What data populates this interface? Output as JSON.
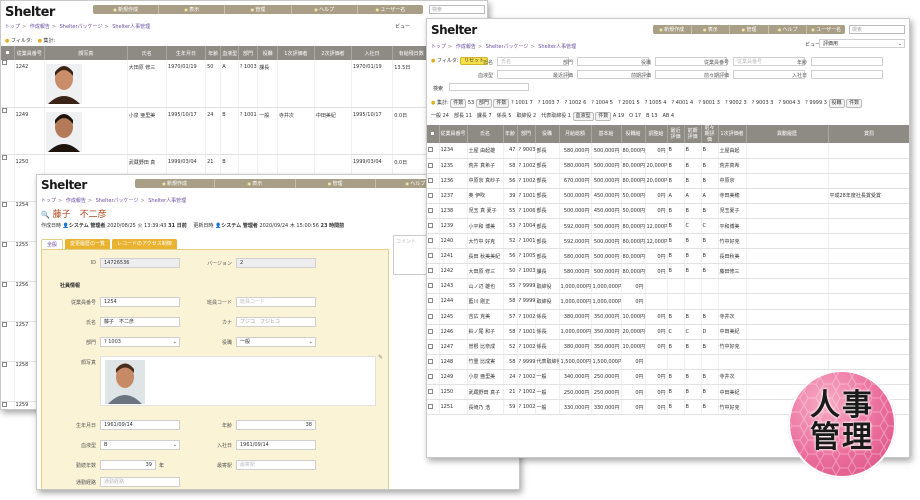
{
  "menu": [
    "新規作成",
    "表示",
    "管理",
    "ヘルプ",
    "ユーザー名"
  ],
  "search_placeholder": "検索",
  "logo": "Shelter",
  "breadcrumb": [
    "トップ",
    "作成報告",
    "Shelterパッケージ",
    "Shelter人事管理"
  ],
  "view_label": "ビュー",
  "view_value": "評価用",
  "filter_label": "フィルタ:",
  "reset_label": "リセット",
  "total_label": "集計:",
  "w1": {
    "headers": [
      "",
      "従業員番号",
      "顔写真",
      "氏名",
      "生年月日",
      "年齢",
      "血液型",
      "部門",
      "役職",
      "1次評価者",
      "2次評価者",
      "入社日",
      "有給残日数",
      "携帯電話番号"
    ],
    "rows": [
      {
        "id": "1242",
        "name": "大田原 修三",
        "birth": "1970/01/19",
        "age": "50",
        "blood": "A",
        "dept": "? 1003",
        "pos": "課長",
        "e1": "",
        "e2": "",
        "join": "1970/01/19",
        "paid": "13.5日",
        "tel": "010-2345-6789"
      },
      {
        "id": "1249",
        "name": "小泉 亜里美",
        "birth": "1995/10/17",
        "age": "24",
        "blood": "B",
        "dept": "? 1001",
        "pos": "一般",
        "e1": "寺井次",
        "e2": "中田美紀",
        "join": "1995/10/17",
        "paid": "0.0日",
        "tel": "010-2345-6789"
      },
      {
        "id": "1250",
        "name": "武蔵野田 真",
        "birth": "1999/03/04",
        "age": "21",
        "blood": "B",
        "dept": "",
        "pos": "",
        "e1": "",
        "e2": "",
        "join": "1999/03/04",
        "paid": "0.0日",
        "tel": "010-2345-6789"
      }
    ],
    "extra_ids": [
      "1254",
      "1255",
      "1256",
      "1257",
      "1258",
      "1259"
    ]
  },
  "w2": {
    "header_name": "藤子　不二彦",
    "created_label": "作成日時",
    "created_by": "システム 管理者",
    "created_at": "2020/08/25 火 13:39:43",
    "created_ago": "31 日前",
    "updated_label": "更新日時",
    "updated_by": "システム 管理者",
    "updated_at": "2020/09/24 木 15:00:56",
    "updated_ago": "23 時間前",
    "comment_placeholder": "コメント",
    "tabs": [
      "全般",
      "変更履歴の一覧",
      "レコードのアクセス制御"
    ],
    "id_label": "ID",
    "id_value": "14726536",
    "version_label": "バージョン",
    "version_value": "2",
    "section_label": "社員情報",
    "emp_no_label": "従業員番号",
    "emp_no_value": "1254",
    "shift_label": "班員コード",
    "shift_placeholder": "班員コード",
    "name_label": "氏名",
    "name_value": "藤子　不二彦",
    "kana_label": "カナ",
    "kana_value": "フジコ　フジヒコ",
    "dept_label": "部門",
    "dept_value": "? 1003",
    "pos_label": "役職",
    "pos_value": "一般",
    "photo_label": "顔写真",
    "birth_label": "生年月日",
    "birth_value": "1961/09/14",
    "age_label": "年齢",
    "age_value": "38",
    "blood_label": "血液型",
    "blood_value": "B",
    "join_label": "入社日",
    "join_value": "1961/09/14",
    "service_label": "勤続年数",
    "service_value": "39",
    "service_unit": "年",
    "station_label": "最寄駅",
    "station_placeholder": "最寄駅",
    "route_label": "通勤経路",
    "route_placeholder": "通勤経路"
  },
  "w3": {
    "filters1": [
      {
        "label": "氏名",
        "placeholder": "氏名"
      },
      {
        "label": "部門",
        "placeholder": ""
      },
      {
        "label": "役職",
        "placeholder": ""
      },
      {
        "label": "従業員番号",
        "placeholder": "従業員番号"
      },
      {
        "label": "年齢",
        "placeholder": ""
      }
    ],
    "filters2": [
      {
        "label": "血液型",
        "placeholder": ""
      },
      {
        "label": "最近評価",
        "placeholder": ""
      },
      {
        "label": "前期評価",
        "placeholder": ""
      },
      {
        "label": "前々期評価",
        "placeholder": ""
      },
      {
        "label": "入社日",
        "placeholder": ""
      }
    ],
    "search_label": "検索",
    "total_dropdown": "件数",
    "total_count": "53",
    "dept_btn": "部門",
    "dept_btn2": "件数",
    "dept_counts": "? 1001 7　? 1003 7　? 1002 6　? 1004 5　? 2001 5　? 1005 4　? 4001 4　? 9001 3　? 9002 3　? 9003 3　? 9004 3　? 9999 3",
    "pos_btn": "役職",
    "pos_btn2": "件数",
    "pos_counts": "一般 24　部長 11　課長 7　係長 5　取締役 2　代表取締役 1",
    "blood_btn": "血液型",
    "blood_btn2": "件数",
    "blood_counts": "A 19　O 17　B 13　AB 4",
    "headers": [
      "",
      "従業員番号",
      "氏名",
      "年齢",
      "部門",
      "役職",
      "月給総額",
      "基本給",
      "役職給",
      "調整給",
      "最近評価",
      "前期評価",
      "前々期評価",
      "1次評価者",
      "異動履歴",
      "賞罰"
    ],
    "rows": [
      {
        "id": "1234",
        "name": "土屋 由起雄",
        "age": "47",
        "dept": "? 9003",
        "pos": "部長",
        "total": "580,000円",
        "base": "500,000円",
        "role": "80,000円",
        "adj": "0円",
        "r1": "B",
        "r2": "B",
        "r3": "B",
        "e1": "土屋由起",
        "move": "",
        "award": ""
      },
      {
        "id": "1235",
        "name": "荒井 真希子",
        "age": "58",
        "dept": "? 1002",
        "pos": "部長",
        "total": "580,000円",
        "base": "500,000円",
        "role": "80,000円",
        "adj": "20,000円",
        "r1": "B",
        "r2": "B",
        "r3": "B",
        "e1": "荒井真希",
        "move": "",
        "award": ""
      },
      {
        "id": "1236",
        "name": "中原京 真紗子",
        "age": "56",
        "dept": "? 1002",
        "pos": "部長",
        "total": "670,000円",
        "base": "500,000円",
        "role": "80,000円",
        "adj": "20,000円",
        "r1": "B",
        "r2": "B",
        "r3": "B",
        "e1": "中原京",
        "move": "",
        "award": ""
      },
      {
        "id": "1237",
        "name": "奥 伊吹",
        "age": "39",
        "dept": "? 1001",
        "pos": "部長",
        "total": "500,000円",
        "base": "450,000円",
        "role": "50,000円",
        "adj": "0円",
        "r1": "A",
        "r2": "A",
        "r3": "A",
        "e1": "寺田美穂",
        "move": "",
        "award": "平成28年度社長賞受賞"
      },
      {
        "id": "1238",
        "name": "児玉 真 夏子",
        "age": "55",
        "dept": "? 1006",
        "pos": "部長",
        "total": "500,000円",
        "base": "450,000円",
        "role": "50,000円",
        "adj": "0円",
        "r1": "B",
        "r2": "B",
        "r3": "B",
        "e1": "児玉夏子",
        "move": "",
        "award": ""
      },
      {
        "id": "1239",
        "name": "小平和 博美",
        "age": "53",
        "dept": "? 1004",
        "pos": "部長",
        "total": "592,000円",
        "base": "500,000円",
        "role": "80,000円",
        "adj": "12,000円",
        "r1": "B",
        "r2": "C",
        "r3": "C",
        "e1": "平和博美",
        "move": "",
        "award": ""
      },
      {
        "id": "1240",
        "name": "大竹中 好克",
        "age": "52",
        "dept": "? 1001",
        "pos": "部長",
        "total": "592,000円",
        "base": "500,000円",
        "role": "80,000円",
        "adj": "12,000円",
        "r1": "B",
        "r2": "B",
        "r3": "B",
        "e1": "竹中好克",
        "move": "",
        "award": ""
      },
      {
        "id": "1241",
        "name": "長田 秋美美紀",
        "age": "56",
        "dept": "? 1005",
        "pos": "部長",
        "total": "580,000円",
        "base": "500,000円",
        "role": "80,000円",
        "adj": "0円",
        "r1": "B",
        "r2": "B",
        "r3": "B",
        "e1": "長田秋美",
        "move": "",
        "award": ""
      },
      {
        "id": "1242",
        "name": "大田原 修三",
        "age": "50",
        "dept": "? 1003",
        "pos": "課長",
        "total": "580,000円",
        "base": "500,000円",
        "role": "80,000円",
        "adj": "0円",
        "r1": "B",
        "r2": "B",
        "r3": "B",
        "e1": "藤田修三",
        "move": "",
        "award": ""
      },
      {
        "id": "1243",
        "name": "山ノ辺 雄也",
        "age": "55",
        "dept": "? 9999",
        "pos": "取締役",
        "total": "1,000,000円",
        "base": "1,000,000円",
        "role": "0円",
        "adj": "",
        "r1": "",
        "r2": "",
        "r3": "",
        "e1": "",
        "move": "",
        "award": ""
      },
      {
        "id": "1244",
        "name": "藍川 剛正",
        "age": "58",
        "dept": "? 9999",
        "pos": "取締役",
        "total": "1,000,000円",
        "base": "1,000,000円",
        "role": "0円",
        "adj": "",
        "r1": "",
        "r2": "",
        "r3": "",
        "e1": "",
        "move": "",
        "award": ""
      },
      {
        "id": "1245",
        "name": "吉広 克美",
        "age": "57",
        "dept": "? 1002",
        "pos": "係長",
        "total": "380,000円",
        "base": "350,000円",
        "role": "10,000円",
        "adj": "0円",
        "r1": "B",
        "r2": "B",
        "r3": "B",
        "e1": "寺井次",
        "move": "",
        "award": ""
      },
      {
        "id": "1246",
        "name": "鈴ノ尾 和子",
        "age": "58",
        "dept": "? 1001",
        "pos": "係長",
        "total": "1,000,000円",
        "base": "350,000円",
        "role": "20,000円",
        "adj": "0円",
        "r1": "C",
        "r2": "C",
        "r3": "D",
        "e1": "中田美紀",
        "move": "",
        "award": ""
      },
      {
        "id": "1247",
        "name": "曽根 比奈成",
        "age": "52",
        "dept": "? 1002",
        "pos": "係長",
        "total": "380,000円",
        "base": "350,000円",
        "role": "10,000円",
        "adj": "0円",
        "r1": "B",
        "r2": "B",
        "r3": "B",
        "e1": "竹中好克",
        "move": "",
        "award": ""
      },
      {
        "id": "1248",
        "name": "竹重 比成実",
        "age": "58",
        "dept": "? 9999",
        "pos": "代表取締役",
        "total": "1,500,000円",
        "base": "1,500,000円",
        "role": "0円",
        "adj": "",
        "r1": "",
        "r2": "",
        "r3": "",
        "e1": "",
        "move": "",
        "award": ""
      },
      {
        "id": "1249",
        "name": "小泉 亜里美",
        "age": "24",
        "dept": "? 1002",
        "pos": "一般",
        "total": "340,000円",
        "base": "250,000円",
        "role": "0円",
        "adj": "0円",
        "r1": "B",
        "r2": "B",
        "r3": "B",
        "e1": "寺井次",
        "move": "",
        "award": ""
      },
      {
        "id": "1250",
        "name": "武蔵野田 真子",
        "age": "21",
        "dept": "? 1002",
        "pos": "一般",
        "total": "250,000円",
        "base": "250,000円",
        "role": "0円",
        "adj": "0円",
        "r1": "B",
        "r2": "B",
        "r3": "B",
        "e1": "中田美紀",
        "move": "",
        "award": ""
      },
      {
        "id": "1251",
        "name": "長崎乃 浩",
        "age": "59",
        "dept": "? 1002",
        "pos": "一般",
        "total": "330,000円",
        "base": "330,000円",
        "role": "0円",
        "adj": "0円",
        "r1": "B",
        "r2": "B",
        "r3": "B",
        "e1": "竹中好克",
        "move": "",
        "award": ""
      }
    ]
  },
  "badge_text": "人事\n管理",
  "colors": {
    "menubar": "#a89f86",
    "header": "#8e8b84",
    "tab": "#e9b230",
    "form_bg": "#fbf3d6",
    "badge": "#ea6c9b"
  }
}
